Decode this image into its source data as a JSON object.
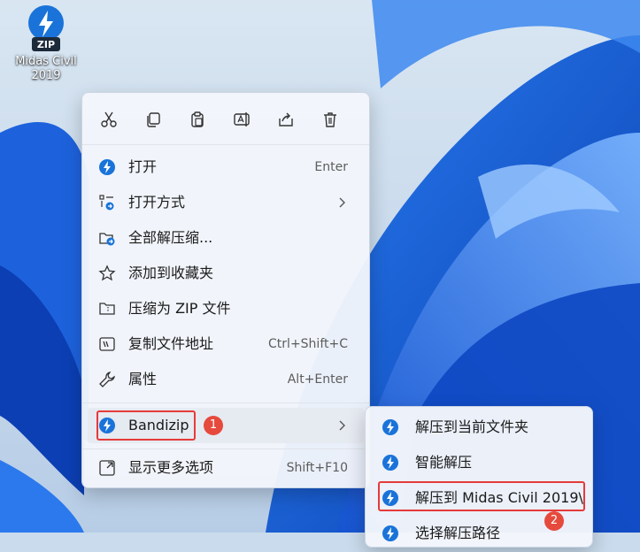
{
  "desktop": {
    "icon_name": "zip-file-icon",
    "icon_text": "ZIP",
    "label_line1": "Midas Civil",
    "label_line2": "2019"
  },
  "toolbar": {
    "buttons": [
      {
        "name": "cut",
        "icon": "scissors-icon"
      },
      {
        "name": "copy",
        "icon": "copy-icon"
      },
      {
        "name": "paste",
        "icon": "paste-icon"
      },
      {
        "name": "rename",
        "icon": "rename-icon"
      },
      {
        "name": "share",
        "icon": "share-icon"
      },
      {
        "name": "delete",
        "icon": "trash-icon"
      }
    ]
  },
  "menu": {
    "items": [
      {
        "label": "打开",
        "shortcut": "Enter",
        "icon": "bandizip-icon"
      },
      {
        "label": "打开方式",
        "shortcut": "",
        "icon": "open-with-icon",
        "submenu": true
      },
      {
        "label": "全部解压缩...",
        "shortcut": "",
        "icon": "extract-folder-icon"
      },
      {
        "label": "添加到收藏夹",
        "shortcut": "",
        "icon": "star-icon"
      },
      {
        "label": "压缩为 ZIP 文件",
        "shortcut": "",
        "icon": "zip-folder-icon"
      },
      {
        "label": "复制文件地址",
        "shortcut": "Ctrl+Shift+C",
        "icon": "copy-path-icon"
      },
      {
        "label": "属性",
        "shortcut": "Alt+Enter",
        "icon": "wrench-icon"
      }
    ],
    "bandizip": {
      "label": "Bandizip",
      "badge": "1",
      "icon": "bandizip-icon"
    },
    "more": {
      "label": "显示更多选项",
      "shortcut": "Shift+F10",
      "icon": "more-options-icon"
    }
  },
  "submenu": {
    "items": [
      {
        "label": "解压到当前文件夹",
        "icon": "bandizip-icon"
      },
      {
        "label": "智能解压",
        "icon": "bandizip-icon"
      },
      {
        "label": "解压到 Midas Civil 2019\\",
        "icon": "bandizip-icon",
        "badge": "2"
      },
      {
        "label": "选择解压路径",
        "icon": "bandizip-icon"
      }
    ]
  },
  "colors": {
    "accent": "#1a73d9",
    "highlight_border": "#e63a3a",
    "badge": "#e64a3c",
    "wallpaper_blue": "#1f6fe0"
  }
}
